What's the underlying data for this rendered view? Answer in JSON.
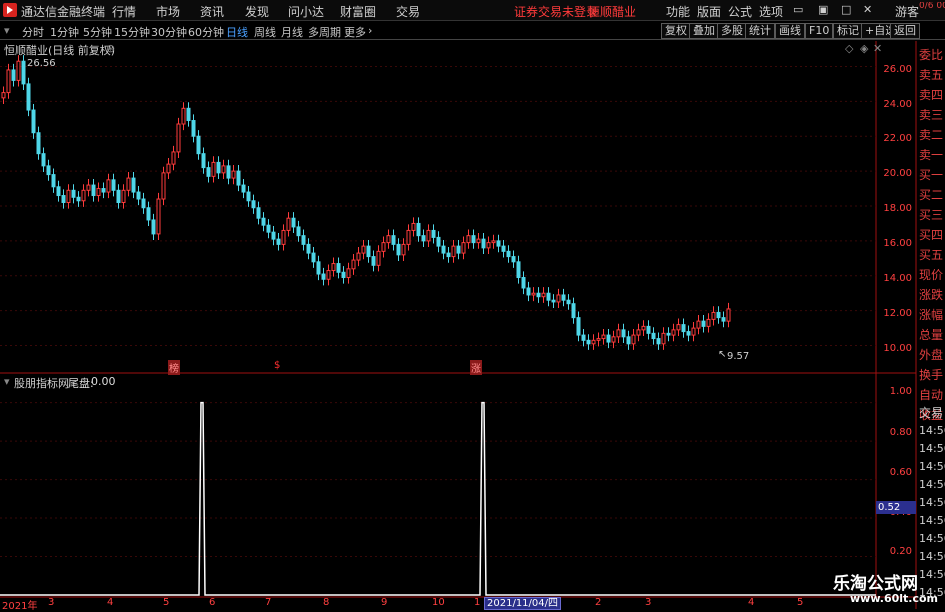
{
  "app": {
    "title": "通达信金融终端",
    "menus": [
      "行情",
      "市场",
      "资讯",
      "发现",
      "问小达",
      "财富圈",
      "交易"
    ],
    "notice": "证券交易未登录",
    "stock": "恒顺醋业",
    "right_menus": [
      "功能",
      "版面",
      "公式",
      "选项"
    ],
    "guest": "游客"
  },
  "toolbar": {
    "periods": [
      "分时",
      "1分钟",
      "5分钟",
      "15分钟",
      "30分钟",
      "60分钟",
      "日线",
      "周线",
      "月线",
      "多周期",
      "更多"
    ],
    "active_period": "日线",
    "right_buttons": [
      "复权",
      "叠加",
      "多股",
      "统计",
      "画线",
      "F10",
      "标记",
      "+自选",
      "返回"
    ]
  },
  "main_panel": {
    "title": "恒顺醋业(日线 前复权)",
    "max_label": "26.56",
    "min_label": "9.57",
    "markers": [
      "榜",
      "$",
      "涨"
    ],
    "price_axis": [
      "26.00",
      "24.00",
      "22.00",
      "20.00",
      "18.00",
      "16.00",
      "14.00",
      "12.00",
      "10.00"
    ]
  },
  "indicator_panel": {
    "title": "股朋指标网",
    "series_label": "尾盘:",
    "series_value": "0.00",
    "axis": [
      "1.00",
      "0.80",
      "0.60",
      "0.40",
      "0.20"
    ],
    "highlight": "0.52"
  },
  "xaxis": {
    "labels": [
      "2021年",
      "3",
      "4",
      "5",
      "6",
      "7",
      "8",
      "9",
      "10",
      "11",
      "2",
      "3",
      "4",
      "5"
    ],
    "selected": "2021/11/04/四",
    "year_label": "1"
  },
  "sidebar": {
    "top_label": "0/6\n0000",
    "labels": [
      "委比",
      "卖五",
      "卖四",
      "卖三",
      "卖二",
      "卖一",
      "买一",
      "买二",
      "买三",
      "买四",
      "买五",
      "现价",
      "涨跌",
      "涨幅",
      "总量",
      "外盘",
      "换手",
      "净资",
      "收益"
    ],
    "lower_labels": [
      "自动",
      "交易"
    ],
    "times": [
      "14:56",
      "14:56",
      "14:56",
      "14:56",
      "14:56",
      "14:56",
      "14:56",
      "14:56",
      "14:56",
      "14:56"
    ]
  },
  "watermark": {
    "line1": "乐淘公式网",
    "line2": "www.60lt.com"
  },
  "chart_data": {
    "type": "candlestick",
    "title": "恒顺醋业(日线 前复权)",
    "ylim": [
      9,
      27
    ],
    "x": [
      0,
      5,
      10,
      15,
      20,
      25,
      30,
      35,
      40,
      45,
      50,
      55,
      60,
      65,
      70,
      75,
      80,
      85,
      90,
      95,
      100,
      105,
      110,
      115,
      120,
      125,
      130,
      135,
      140,
      145,
      150,
      155,
      160,
      165,
      170,
      175,
      180,
      185,
      190,
      195,
      200,
      205,
      210,
      215,
      220,
      225,
      230,
      235,
      240,
      245,
      250,
      255,
      260,
      265,
      270,
      275,
      280,
      285,
      290,
      295,
      300,
      305,
      310,
      315,
      320,
      325,
      330,
      335,
      340,
      345,
      350,
      355,
      360,
      365,
      370,
      375,
      380,
      385,
      390,
      395,
      400,
      405,
      410,
      415,
      420,
      425,
      430,
      435,
      440,
      445,
      450,
      455,
      460,
      465,
      470,
      475,
      480,
      485,
      490,
      495,
      500,
      505,
      510,
      515,
      520,
      525,
      530,
      535,
      540,
      545,
      550,
      555,
      560,
      565,
      570,
      575,
      580,
      585,
      590,
      595,
      600,
      605,
      610,
      615,
      620,
      625,
      630,
      635,
      640,
      645,
      650,
      655,
      660,
      665,
      670,
      675,
      680,
      685,
      690,
      695,
      700,
      705,
      710,
      715,
      720,
      725,
      730,
      735,
      740,
      745,
      750,
      755,
      760,
      765,
      770,
      775,
      780,
      785,
      790,
      795,
      800,
      805,
      810,
      815,
      820,
      825,
      830,
      835,
      840,
      845,
      850,
      855,
      860,
      865,
      870
    ],
    "close": [
      24.5,
      25.8,
      25.2,
      26.3,
      25.0,
      23.5,
      22.2,
      21.0,
      20.3,
      19.8,
      19.1,
      18.6,
      18.2,
      18.9,
      18.5,
      18.3,
      18.9,
      19.2,
      18.6,
      19.0,
      18.8,
      19.5,
      18.9,
      18.2,
      18.9,
      19.6,
      18.8,
      18.4,
      17.9,
      17.2,
      16.4,
      18.4,
      19.9,
      20.4,
      21.1,
      22.7,
      23.6,
      22.9,
      22.0,
      21.0,
      20.2,
      19.7,
      20.5,
      19.9,
      20.3,
      19.6,
      20.0,
      19.2,
      18.8,
      18.3,
      17.9,
      17.3,
      16.9,
      16.5,
      16.1,
      15.8,
      16.6,
      17.3,
      16.8,
      16.3,
      15.8,
      15.3,
      14.8,
      14.1,
      13.8,
      14.3,
      14.7,
      14.2,
      13.9,
      14.4,
      14.9,
      15.3,
      15.7,
      15.1,
      14.6,
      15.4,
      15.9,
      16.3,
      15.8,
      15.2,
      15.8,
      16.6,
      17.0,
      16.3,
      16.0,
      16.6,
      16.2,
      15.7,
      15.3,
      15.1,
      15.7,
      15.3,
      15.9,
      16.3,
      15.9,
      16.1,
      15.6,
      15.9,
      16.0,
      15.7,
      15.4,
      15.1,
      14.8,
      13.9,
      13.3,
      12.9,
      13.0,
      12.8,
      13.0,
      12.6,
      12.5,
      12.9,
      12.6,
      12.4,
      11.6,
      10.6,
      10.3,
      10.1,
      10.3,
      10.4,
      10.6,
      10.2,
      10.5,
      10.9,
      10.5,
      10.1,
      10.6,
      10.9,
      11.1,
      10.7,
      10.4,
      10.1,
      10.7,
      10.6,
      10.9,
      11.2,
      10.8,
      10.6,
      11.0,
      11.4,
      11.1,
      11.5,
      11.9,
      11.6,
      11.4,
      12.1
    ],
    "indicator": {
      "name": "尾盘",
      "spikes_at_x": [
        202,
        483
      ],
      "value": 0.0,
      "ylim": [
        0,
        1.05
      ]
    }
  }
}
